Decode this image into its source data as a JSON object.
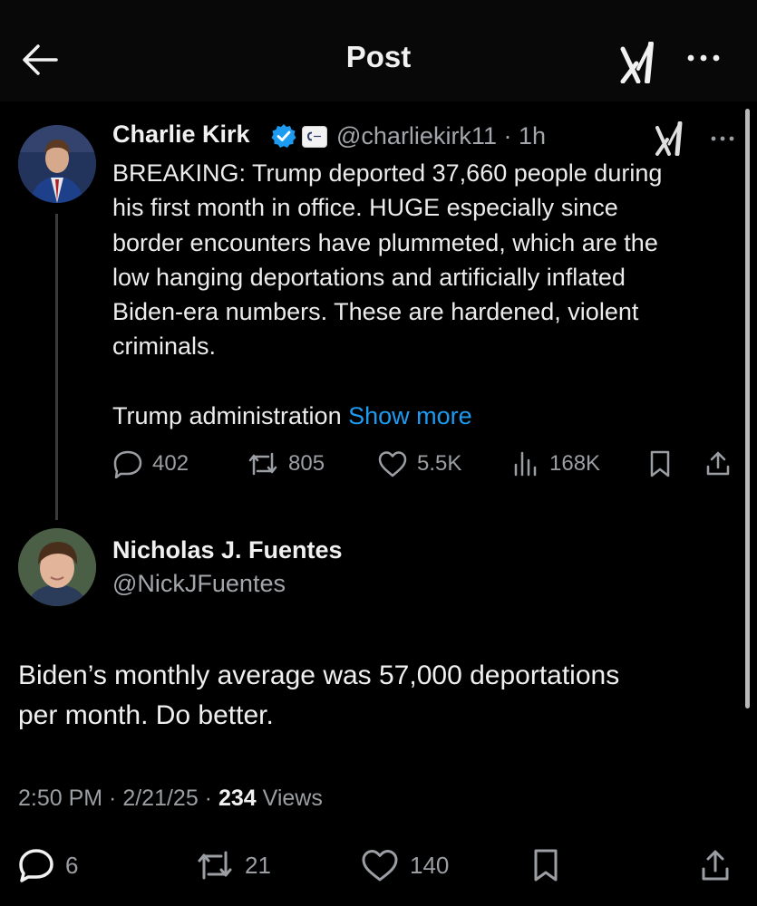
{
  "header": {
    "title": "Post"
  },
  "quoted_post": {
    "author_name": "Charlie Kirk",
    "handle": "@charliekirk11",
    "time": "· 1h",
    "text_lines": [
      "BREAKING: Trump deported 37,660 people during",
      "his first month in office. HUGE especially since",
      "border encounters have plummeted, which are the",
      "low hanging deportations and artificially inflated",
      "Biden-era numbers. These are hardened, violent",
      "criminals."
    ],
    "text_tail": "Trump administration",
    "show_more": "Show more",
    "stats": {
      "replies": "402",
      "reposts": "805",
      "likes": "5.5K",
      "views": "168K"
    }
  },
  "main_post": {
    "author_name": "Nicholas J. Fuentes",
    "handle": "@NickJFuentes",
    "text_line1": "Biden’s monthly average was 57,000 deportations",
    "text_line2": "per month. Do better.",
    "timestamp": "2:50 PM · 2/21/25 · ",
    "views_count": "234",
    "views_label": " Views",
    "stats": {
      "replies": "6",
      "reposts": "21",
      "likes": "140"
    }
  },
  "colors": {
    "accent": "#1d9bf0",
    "background": "#000000",
    "muted": "#9b9ea3"
  },
  "icons": [
    "back-arrow-icon",
    "grok-icon",
    "more-icon",
    "verified-icon",
    "reply-icon",
    "repost-icon",
    "like-icon",
    "views-icon",
    "bookmark-icon",
    "share-icon"
  ]
}
